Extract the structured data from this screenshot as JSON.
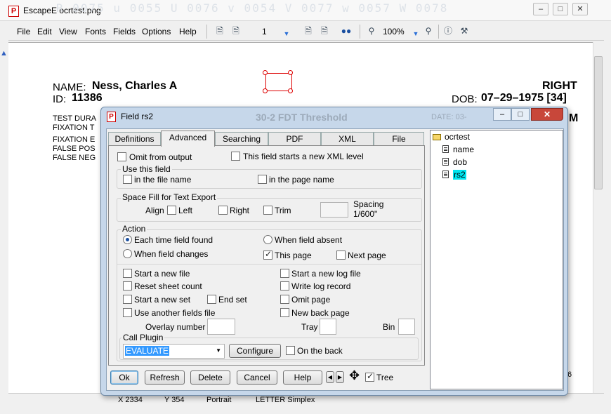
{
  "window": {
    "title": "EscapeE ocrtest.png",
    "watermark": "R 0075 u 0055 U 0076 v 0054 V 0077 w 0057 W 0078",
    "controls": {
      "minimize": "–",
      "maximize": "□",
      "close": "✕"
    }
  },
  "menu": [
    "File",
    "Edit",
    "View",
    "Fonts",
    "Fields",
    "Options",
    "Help"
  ],
  "toolbar": {
    "page_number": "1",
    "zoom": "100%"
  },
  "document": {
    "name_label": "NAME:",
    "name_value": "Ness, Charles A",
    "id_label": "ID:",
    "id_value": "11386",
    "eye": "RIGHT",
    "dob_label": "DOB:",
    "dob_value": "07–29–1975 [34]",
    "test_duration": "TEST DURA",
    "fixation_target": "FIXATION T",
    "fixation_errors": "FIXATION E",
    "false_pos": "FALSE POS",
    "false_neg": "FALSE NEG",
    "test_name": "30-2 FDT Threshold",
    "date_label": "DATE: 03-",
    "edge_letter": "M",
    "side_fragment": "6"
  },
  "status": {
    "x": "X 2334",
    "y": "Y 354",
    "orientation": "Portrait",
    "paper": "LETTER Simplex"
  },
  "dialog": {
    "title": "Field rs2",
    "tabs": [
      "Definitions",
      "Advanced",
      "Searching",
      "PDF",
      "XML",
      "File"
    ],
    "active_tab": "Advanced",
    "omit_from_output": "Omit from output",
    "new_xml_level": "This field starts a new XML level",
    "use_this_field": {
      "label": "Use this field",
      "in_file_name": "in the file name",
      "in_page_name": "in the page name"
    },
    "space_fill": {
      "label": "Space Fill for Text Export",
      "align": "Align",
      "left": "Left",
      "right": "Right",
      "trim": "Trim",
      "spacing": "Spacing",
      "spacing_unit": "1/600\""
    },
    "action": {
      "label": "Action",
      "each_time": "Each time field found",
      "when_absent": "When field absent",
      "when_changes": "When field changes",
      "this_page": "This page",
      "next_page": "Next page",
      "start_new_file": "Start a new file",
      "start_new_log": "Start a new log file",
      "reset_sheet_count": "Reset sheet count",
      "write_log_record": "Write log record",
      "start_new_set": "Start a new set",
      "end_set": "End set",
      "omit_page": "Omit page",
      "use_another_fields_file": "Use another fields file",
      "new_back_page": "New back page",
      "overlay_number": "Overlay number",
      "tray": "Tray",
      "bin": "Bin"
    },
    "call_plugin": {
      "label": "Call Plugin",
      "selected": "EVALUATE",
      "configure": "Configure",
      "on_the_back": "On the back"
    },
    "buttons": {
      "ok": "Ok",
      "refresh": "Refresh",
      "delete": "Delete",
      "cancel": "Cancel",
      "help": "Help",
      "tree": "Tree"
    },
    "tree": {
      "root": "ocrtest",
      "items": [
        "name",
        "dob",
        "rs2"
      ],
      "selected": "rs2"
    }
  },
  "colors": {
    "selection": "#00e5f0",
    "plugin_highlight": "#3399ff",
    "dialog_frame": "#c6d7ea",
    "close_red": "#c8473a"
  }
}
